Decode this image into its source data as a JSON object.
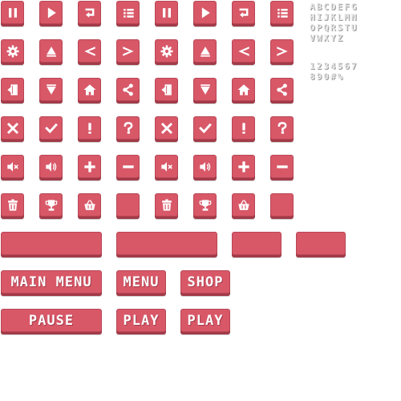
{
  "colors": {
    "button": "#d85868",
    "button_dark": "#a23a48",
    "glyph": "#e8e8e8"
  },
  "icon_rows": [
    [
      "pause-icon",
      "play-icon",
      "replay-icon",
      "list-icon",
      "pause-icon",
      "play-icon",
      "replay-icon",
      "list-icon"
    ],
    [
      "gear-icon",
      "arrow-up-icon",
      "arrow-left-icon",
      "arrow-right-icon",
      "gear-icon",
      "arrow-up-icon",
      "arrow-left-icon",
      "arrow-right-icon"
    ],
    [
      "exit-icon",
      "arrow-down-icon",
      "home-icon",
      "share-icon",
      "exit-icon",
      "arrow-down-icon",
      "home-icon",
      "share-icon"
    ],
    [
      "close-icon",
      "check-icon",
      "exclamation-icon",
      "question-icon",
      "close-icon",
      "check-icon",
      "exclamation-icon",
      "question-icon"
    ],
    [
      "sound-off-icon",
      "sound-on-icon",
      "plus-icon",
      "minus-icon",
      "sound-off-icon",
      "sound-on-icon",
      "plus-icon",
      "minus-icon"
    ],
    [
      "trash-icon",
      "trophy-icon",
      "basket-icon",
      "blank",
      "trash-icon",
      "trophy-icon",
      "basket-icon",
      "blank"
    ]
  ],
  "labels": {
    "main_menu": "MAIN MENU",
    "menu": "MENU",
    "shop": "SHOP",
    "pause": "PAUSE",
    "play_1": "PLAY",
    "play_2": "PLAY"
  },
  "glyph_sheet": {
    "row1": "ABCDEFG",
    "row2": "HIJKLMN",
    "row3": "OPQRSTU",
    "row4": "VWXYZ",
    "row5": "1234567",
    "row6": "890#%"
  }
}
